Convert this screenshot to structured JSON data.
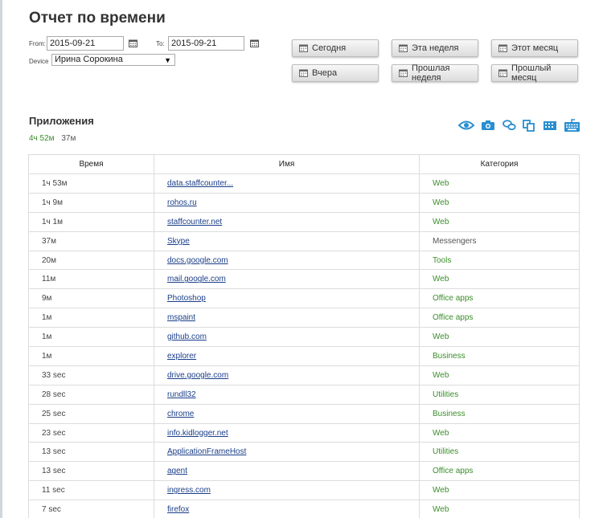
{
  "page": {
    "title": "Отчет по времени"
  },
  "filters": {
    "from_label": "From:",
    "from_value": "2015-09-21",
    "to_label": "To:",
    "to_value": "2015-09-21",
    "device_label": "Device",
    "device_value": "Ирина Сорокина"
  },
  "quick_ranges": {
    "today": "Сегодня",
    "this_week": "Эта неделя",
    "this_month": "Этот месяц",
    "yesterday": "Вчера",
    "last_week": "Прошлая неделя",
    "last_month": "Прошлый месяц"
  },
  "section": {
    "title": "Приложения",
    "total_active": "4ч 52м",
    "total_other": "37м"
  },
  "table": {
    "headers": {
      "time": "Время",
      "name": "Имя",
      "category": "Категория"
    },
    "rows": [
      {
        "time": "1ч 53м",
        "name": "data.staffcounter...",
        "category": "Web",
        "productive": true
      },
      {
        "time": "1ч 9м",
        "name": "rohos.ru",
        "category": "Web",
        "productive": true
      },
      {
        "time": "1ч 1м",
        "name": "staffcounter.net",
        "category": "Web",
        "productive": true
      },
      {
        "time": "37м",
        "name": "Skype",
        "category": "Messengers",
        "productive": false
      },
      {
        "time": "20м",
        "name": "docs.google.com",
        "category": "Tools",
        "productive": true
      },
      {
        "time": "11м",
        "name": "mail.google.com",
        "category": "Web",
        "productive": true
      },
      {
        "time": "9м",
        "name": "Photoshop",
        "category": "Office apps",
        "productive": true
      },
      {
        "time": "1м",
        "name": "mspaint",
        "category": "Office apps",
        "productive": true
      },
      {
        "time": "1м",
        "name": "github.com",
        "category": "Web",
        "productive": true
      },
      {
        "time": "1м",
        "name": "explorer",
        "category": "Business",
        "productive": true
      },
      {
        "time": "33 sec",
        "name": "drive.google.com",
        "category": "Web",
        "productive": true
      },
      {
        "time": "28 sec",
        "name": "rundll32",
        "category": "Utilities",
        "productive": true
      },
      {
        "time": "25 sec",
        "name": "chrome",
        "category": "Business",
        "productive": true
      },
      {
        "time": "23 sec",
        "name": "info.kidlogger.net",
        "category": "Web",
        "productive": true
      },
      {
        "time": "13 sec",
        "name": "ApplicationFrameHost",
        "category": "Utilities",
        "productive": true
      },
      {
        "time": "13 sec",
        "name": "agent",
        "category": "Office apps",
        "productive": true
      },
      {
        "time": "11 sec",
        "name": "ingress.com",
        "category": "Web",
        "productive": true
      },
      {
        "time": "7 sec",
        "name": "firefox",
        "category": "Web",
        "productive": true
      }
    ]
  },
  "icons": {
    "calendar": "calendar-icon",
    "toolbar": [
      "eye-icon",
      "camera-icon",
      "chat-icon",
      "copy-icon",
      "grid-icon",
      "keyboard-icon"
    ]
  },
  "colors": {
    "accent_blue": "#2a8fd0",
    "productive_green": "#3a8d2a",
    "link_blue": "#1a3e88"
  }
}
